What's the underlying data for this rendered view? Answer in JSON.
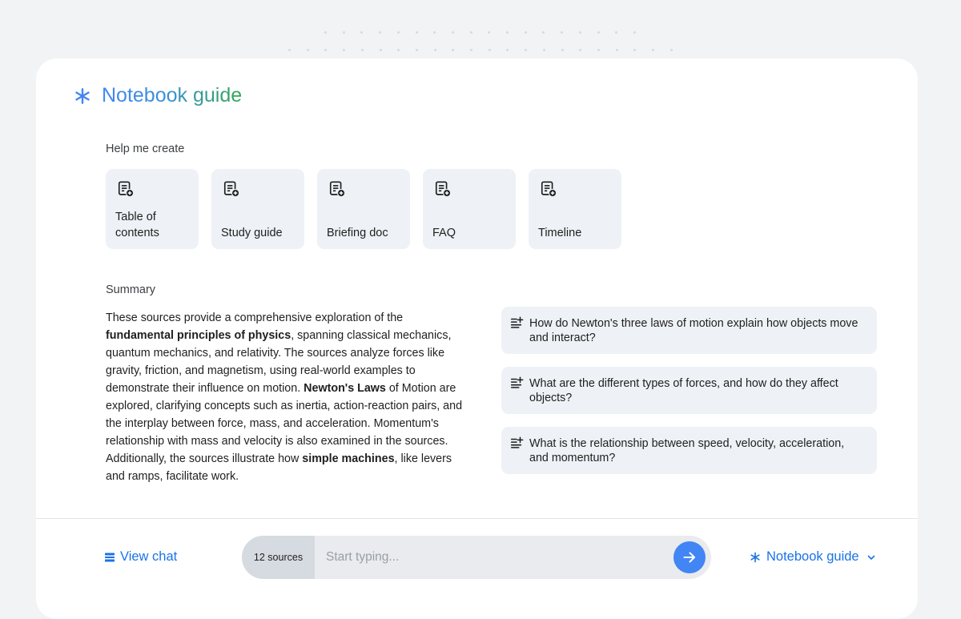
{
  "header": {
    "title": "Notebook guide",
    "icon": "sparkle-star-icon"
  },
  "help_create": {
    "label": "Help me create",
    "items": [
      {
        "label": "Table of contents",
        "icon": "add-note-icon"
      },
      {
        "label": "Study guide",
        "icon": "add-note-icon"
      },
      {
        "label": "Briefing doc",
        "icon": "add-note-icon"
      },
      {
        "label": "FAQ",
        "icon": "add-note-icon"
      },
      {
        "label": "Timeline",
        "icon": "add-note-icon"
      }
    ]
  },
  "summary": {
    "label": "Summary",
    "segments": [
      {
        "text": "These sources provide a comprehensive exploration of the ",
        "bold": false
      },
      {
        "text": "fundamental principles of physics",
        "bold": true
      },
      {
        "text": ", spanning classical mechanics, quantum mechanics, and relativity. The sources analyze forces like gravity, friction, and magnetism, using real-world examples to demonstrate their influence on motion. ",
        "bold": false
      },
      {
        "text": "Newton's Laws",
        "bold": true
      },
      {
        "text": " of Motion are explored, clarifying concepts such as inertia, action-reaction pairs, and the interplay between force, mass, and acceleration. Momentum's relationship with mass and velocity is also examined in the sources. Additionally, the sources illustrate how ",
        "bold": false
      },
      {
        "text": "simple machines",
        "bold": true
      },
      {
        "text": ", like levers and ramps, facilitate work.",
        "bold": false
      }
    ]
  },
  "suggested_questions": [
    {
      "text": "How do Newton's three laws of motion explain how objects move and interact?",
      "icon": "suggested-question-icon"
    },
    {
      "text": "What are the different types of forces, and how do they affect objects?",
      "icon": "suggested-question-icon"
    },
    {
      "text": "What is the relationship between speed, velocity, acceleration, and momentum?",
      "icon": "suggested-question-icon"
    }
  ],
  "footer": {
    "view_chat_label": "View chat",
    "view_chat_icon": "chat-lines-icon",
    "sources_label": "12 sources",
    "input_placeholder": "Start typing...",
    "input_value": "",
    "send_icon": "arrow-right-icon",
    "guide_label": "Notebook guide",
    "guide_icon": "sparkle-star-icon",
    "guide_chevron": "chevron-down-icon"
  },
  "colors": {
    "accent": "#1a73e8",
    "send_button": "#4285f4",
    "card_bg": "#eef1f5",
    "title_gradient": [
      "#4285f4",
      "#34a853"
    ]
  }
}
